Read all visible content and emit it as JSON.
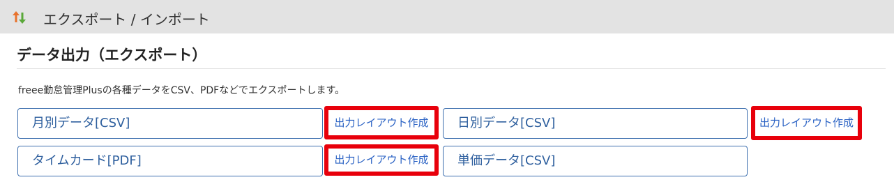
{
  "header": {
    "icon": "up-down-arrows-icon",
    "title": "エクスポート / インポート",
    "colors": {
      "up_arrow": "#e8722c",
      "down_arrow": "#5aa839",
      "background": "#e3e3e3"
    }
  },
  "section": {
    "title": "データ出力（エクスポート）",
    "description": "freee勤怠管理Plusの各種データをCSV、PDFなどでエクスポートします。"
  },
  "exports": [
    {
      "label": "月別データ[CSV]",
      "layout_label": "出力レイアウト作成"
    },
    {
      "label": "日別データ[CSV]",
      "layout_label": "出力レイアウト作成"
    },
    {
      "label": "タイムカード[PDF]",
      "layout_label": "出力レイアウト作成"
    },
    {
      "label": "単価データ[CSV]"
    }
  ],
  "colors": {
    "button_border": "#3d6fae",
    "button_text": "#2e5f9e",
    "highlight_border": "#e8000b",
    "link_text": "#2a62c4"
  }
}
